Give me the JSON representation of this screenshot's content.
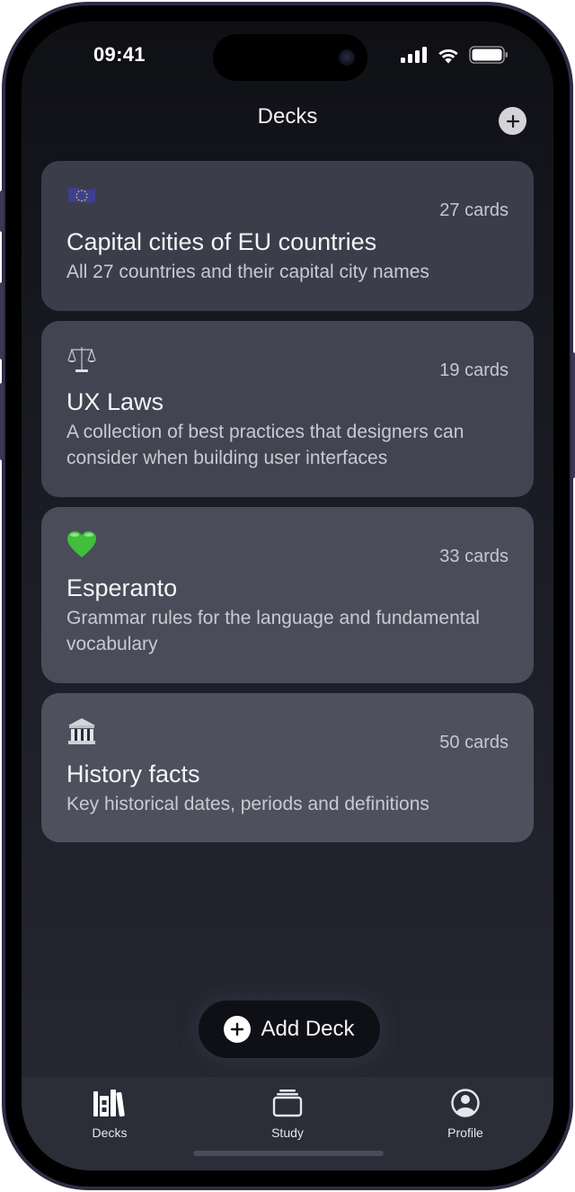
{
  "status_bar": {
    "time": "09:41",
    "icons": [
      "cellular-signal-icon",
      "wifi-icon",
      "battery-icon"
    ]
  },
  "nav": {
    "title": "Decks",
    "add_icon": "plus-circle-icon"
  },
  "decks": [
    {
      "emoji": "eu-flag-icon",
      "count": "27 cards",
      "title": "Capital cities of EU countries",
      "description": "All 27 countries and their capital city names",
      "bg": "#3b3d4a"
    },
    {
      "emoji": "balance-scale-icon",
      "count": "19 cards",
      "title": "UX Laws",
      "description": "A collection of best practices that designers can consider when building user interfaces",
      "bg": "#424452"
    },
    {
      "emoji": "green-heart-icon",
      "count": "33 cards",
      "title": "Esperanto",
      "description": "Grammar rules for the language and fundamental vocabulary",
      "bg": "#4a4c5a"
    },
    {
      "emoji": "classical-building-icon",
      "count": "50 cards",
      "title": "History facts",
      "description": "Key historical dates, periods and definitions",
      "bg": "#4e505e"
    }
  ],
  "add_deck_button": {
    "label": "Add Deck",
    "icon": "plus-circle-icon"
  },
  "tab_bar": {
    "tabs": [
      {
        "label": "Decks",
        "icon": "books-icon",
        "active": true
      },
      {
        "label": "Study",
        "icon": "card-stack-icon",
        "active": false
      },
      {
        "label": "Profile",
        "icon": "person-circle-icon",
        "active": false
      }
    ]
  },
  "colors": {
    "accent_text": "#f4f4f6",
    "secondary_text": "#c9cad1",
    "tab_bar_bg": "#2b2d38",
    "button_dark": "#0f1015"
  }
}
